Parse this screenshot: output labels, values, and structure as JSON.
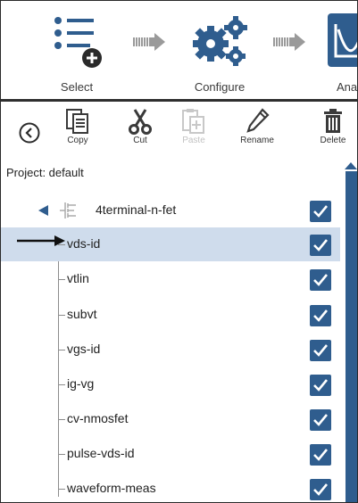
{
  "workflow": {
    "steps": [
      {
        "label": "Select"
      },
      {
        "label": "Configure"
      },
      {
        "label": "Ana"
      }
    ]
  },
  "toolbar": {
    "copy": "Copy",
    "cut": "Cut",
    "paste": "Paste",
    "rename": "Rename",
    "delete": "Delete"
  },
  "project": {
    "label": "Project: default"
  },
  "tree": {
    "device": {
      "label": "4terminal-n-fet",
      "checked": true
    },
    "tests": [
      {
        "label": "vds-id",
        "checked": true,
        "selected": true
      },
      {
        "label": "vtlin",
        "checked": true
      },
      {
        "label": "subvt",
        "checked": true
      },
      {
        "label": "vgs-id",
        "checked": true
      },
      {
        "label": "ig-vg",
        "checked": true
      },
      {
        "label": "cv-nmosfet",
        "checked": true
      },
      {
        "label": "pulse-vds-id",
        "checked": true
      },
      {
        "label": "waveform-meas",
        "checked": true
      }
    ]
  },
  "colors": {
    "accent": "#2f5d8e",
    "selected_row": "#cfdcec"
  }
}
